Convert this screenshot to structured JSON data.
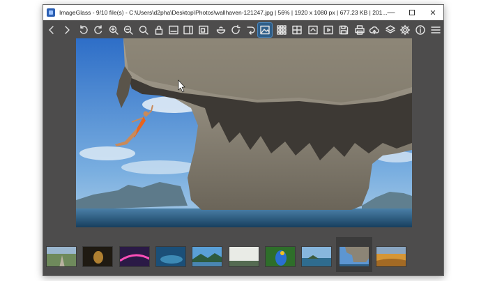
{
  "window": {
    "title": "ImageGlass - 9/10 file(s) - C:\\Users\\d2pha\\Desktop\\Photos\\wallhaven-121247.jpg  |  56%  |  1920 x 1080 px  |  677.23 KB  |  201...",
    "controls": [
      "minimize-icon",
      "maximize-icon",
      "close-icon"
    ]
  },
  "toolbar": {
    "buttons": [
      "chevron-left-icon",
      "chevron-right-icon",
      "rotate-left-icon",
      "rotate-right-icon",
      "zoom-in-icon",
      "zoom-out-icon",
      "zoom-actual-icon",
      "lock-zoom-icon",
      "fit-width-icon",
      "fit-height-icon",
      "scale-to-fit-icon",
      "bowl-icon",
      "refresh-icon",
      "go-to-icon",
      "image-icon-active",
      "thumbnail-grid-icon",
      "checkerboard-icon",
      "fullscreen-icon",
      "slideshow-icon",
      "save-icon",
      "print-icon",
      "upload-icon",
      "layers-icon",
      "gear-icon",
      "info-icon",
      "menu-icon"
    ],
    "active_button": "image-icon-active"
  },
  "image": {
    "name": "wallhaven-121247.jpg",
    "zoom": "56%",
    "dimensions": "1920 x 1080 px",
    "size": "677.23 KB"
  },
  "thumbnails": {
    "count": 10,
    "selected_index": 8
  },
  "colors": {
    "window_bg": "#4d4c4c",
    "titlebar_bg": "#ffffff",
    "active_tool": "#2f5f8a"
  }
}
